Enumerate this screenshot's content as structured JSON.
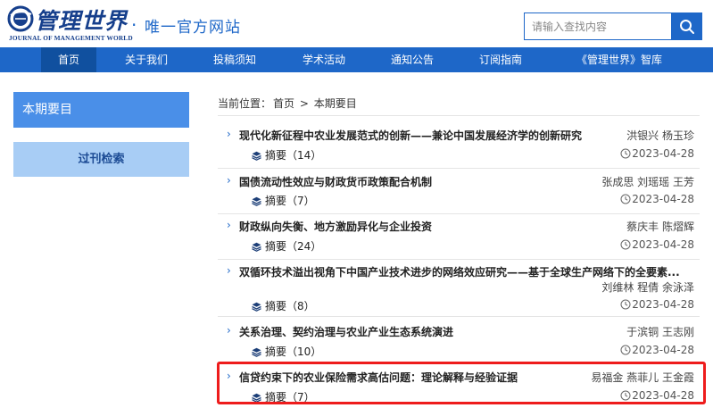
{
  "header": {
    "logo_title": "管理世界",
    "logo_sub": "JOURNAL OF MANAGEMENT WORLD",
    "slogan_dot": "·",
    "slogan": "唯一官方网站",
    "search_placeholder": "请输入查找内容"
  },
  "nav": {
    "items": [
      {
        "label": "首页"
      },
      {
        "label": "关于我们"
      },
      {
        "label": "投稿须知"
      },
      {
        "label": "学术活动"
      },
      {
        "label": "通知公告"
      },
      {
        "label": "订阅指南"
      },
      {
        "label": "《管理世界》智库"
      }
    ],
    "active_index": 0
  },
  "sidebar": {
    "current": "本期要目",
    "archive": "过刊检索"
  },
  "breadcrumb": {
    "prefix": "当前位置：",
    "home": "首页",
    "sep": ">",
    "current": "本期要目"
  },
  "articles": [
    {
      "title": "现代化新征程中农业发展范式的创新——兼论中国发展经济学的创新研究",
      "authors": "洪银兴 杨玉珍",
      "abstract_label": "摘要（14）",
      "date": "2023-04-28"
    },
    {
      "title": "国债流动性效应与财政货币政策配合机制",
      "authors": "张成思 刘瑶瑶 王芳",
      "abstract_label": "摘要（7）",
      "date": "2023-04-28"
    },
    {
      "title": "财政纵向失衡、地方激励异化与企业投资",
      "authors": "蔡庆丰 陈熠辉",
      "abstract_label": "摘要（24）",
      "date": "2023-04-28"
    },
    {
      "title": "双循环技术溢出视角下中国产业技术进步的网络效应研究——基于全球生产网络下的全要素...",
      "authors": "刘维林 程倩 余泳泽",
      "abstract_label": "摘要（8）",
      "date": "2023-04-28"
    },
    {
      "title": "关系治理、契约治理与农业产业生态系统演进",
      "authors": "于滨铜 王志刚",
      "abstract_label": "摘要（10）",
      "date": "2023-04-28"
    },
    {
      "title": "信贷约束下的农业保险需求高估问题：理论解释与经验证据",
      "authors": "易福金 燕菲儿 王金霞",
      "abstract_label": "摘要（7）",
      "date": "2023-04-28"
    }
  ],
  "colors": {
    "brand_blue": "#1e67c8",
    "nav_active": "#10509f",
    "highlight_red": "#ee1c1c"
  }
}
